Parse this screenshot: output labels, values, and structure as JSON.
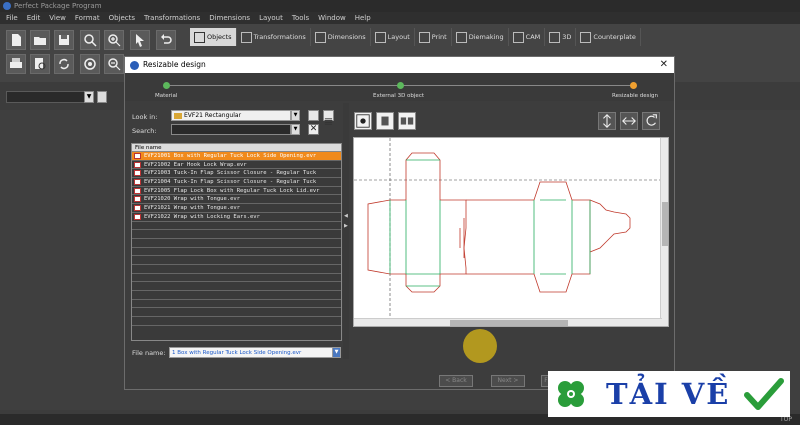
{
  "app": {
    "title": "Perfect Package Program"
  },
  "menu": [
    "File",
    "Edit",
    "View",
    "Format",
    "Objects",
    "Transformations",
    "Dimensions",
    "Layout",
    "Tools",
    "Window",
    "Help"
  ],
  "ribbon_tabs": [
    "Objects",
    "Transformations",
    "Dimensions",
    "Layout",
    "Print",
    "Diemaking",
    "CAM",
    "3D",
    "Counterplate"
  ],
  "dialog": {
    "title": "Resizable design",
    "steps": [
      {
        "label": "Material",
        "color": "#5cb85c"
      },
      {
        "label": "External 3D object",
        "color": "#5cb85c"
      },
      {
        "label": "Resizable design",
        "color": "#f0a030"
      }
    ],
    "look_in_label": "Look in:",
    "look_in_value": "EVF21 Rectangular",
    "search_label": "Search:",
    "file_list_header": "File name",
    "files": [
      "EVF21001 Box with Regular Tuck Lock Side Opening.evr",
      "EVF21002 Ear Hook Lock Wrap.evr",
      "EVF21003 Tuck-In Flap Scissor Closure - Regular Tuck",
      "EVF21004 Tuck-In Flap Scissor Closure - Regular Tuck",
      "EVF21005 Flap Lock Box with Regular Tuck Lock Lid.evr",
      "EVF21020 Wrap with Tongue.evr",
      "EVF21021 Wrap with Tongue.evr",
      "EVF21022 Wrap with Locking Ears.evr"
    ],
    "selected_index": 0,
    "file_name_label": "File name:",
    "file_name_value": "1 Box with Regular Tuck Lock Side Opening.evr",
    "back_label": "< Back",
    "next_label": "Next >",
    "finish_label": "F"
  },
  "statusbar": {
    "text": "TOP"
  },
  "watermark": {
    "text": "TẢI VỀ"
  },
  "colors": {
    "cut_line": "#c0392b",
    "crease_line": "#27ae60",
    "selection": "#f08a1c",
    "accent": "#2c5fb8"
  }
}
